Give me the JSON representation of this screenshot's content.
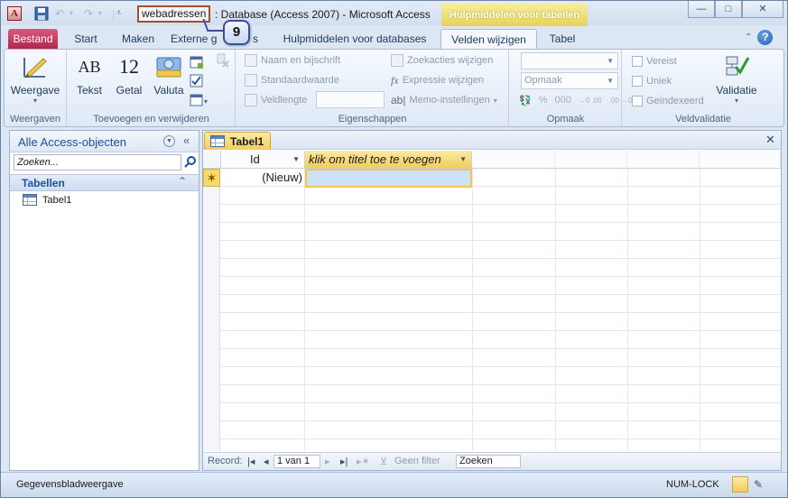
{
  "titlebar": {
    "db_name": "webadressen",
    "title_rest": ": Database (Access 2007)  -  Microsoft Access",
    "contextual_tab": "Hulpmiddelen voor tabellen",
    "min": "—",
    "max": "□",
    "close": "✕"
  },
  "callout": {
    "number": "9"
  },
  "tabs": {
    "bestand": "Bestand",
    "start": "Start",
    "maken": "Maken",
    "externe": "Externe g",
    "externe_tail": "s",
    "hulpdb": "Hulpmiddelen voor databases",
    "velden": "Velden wijzigen",
    "tabel": "Tabel",
    "help": "?"
  },
  "ribbon": {
    "weergave_label": "Weergave",
    "group_weergaven": "Weergaven",
    "tekst": "Tekst",
    "tekst_icon": "AB",
    "getal": "Getal",
    "getal_icon": "12",
    "valuta": "Valuta",
    "group_toevoegen": "Toevoegen en verwijderen",
    "naam": "Naam en bijschrift",
    "standaard": "Standaardwaarde",
    "veldlengte": "Veldlengte",
    "zoekacties": "Zoekacties wijzigen",
    "expressie": "Expressie wijzigen",
    "memo": "Memo-instellingen",
    "group_eigenschappen": "Eigenschappen",
    "opmaak_dd": "Opmaak",
    "group_opmaak": "Opmaak",
    "vereist": "Vereist",
    "uniek": "Uniek",
    "geindexeerd": "Geïndexeerd",
    "validatie": "Validatie",
    "group_validatie": "Veldvalidatie"
  },
  "nav": {
    "title": "Alle Access-objecten",
    "search_placeholder": "Zoeken...",
    "group": "Tabellen",
    "items": [
      {
        "label": "Tabel1"
      }
    ]
  },
  "doc": {
    "tab_label": "Tabel1",
    "columns": [
      {
        "label": "Id"
      },
      {
        "label": "klik om titel toe te voegen"
      }
    ],
    "new_row_marker": "✶",
    "new_row_value": "(Nieuw)"
  },
  "recbar": {
    "record_label": "Record:",
    "position": "1 van 1",
    "filter": "Geen filter",
    "search": "Zoeken"
  },
  "status": {
    "view": "Gegevensbladweergave",
    "numlock": "NUM-LOCK"
  }
}
